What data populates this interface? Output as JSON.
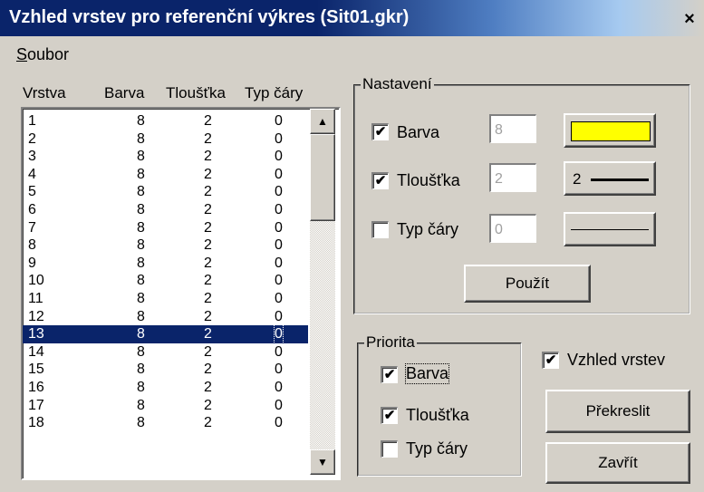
{
  "window": {
    "title": "Vzhled vrstev pro referenční výkres (Sit01.gkr)",
    "close_glyph": "×"
  },
  "menu": {
    "file": "Soubor",
    "file_underline_letter": "S",
    "file_rest": "oubor"
  },
  "layers": {
    "columns": [
      "Vrstva",
      "Barva",
      "Tloušťka",
      "Typ čáry"
    ],
    "rows": [
      [
        "1",
        "8",
        "2",
        "0"
      ],
      [
        "2",
        "8",
        "2",
        "0"
      ],
      [
        "3",
        "8",
        "2",
        "0"
      ],
      [
        "4",
        "8",
        "2",
        "0"
      ],
      [
        "5",
        "8",
        "2",
        "0"
      ],
      [
        "6",
        "8",
        "2",
        "0"
      ],
      [
        "7",
        "8",
        "2",
        "0"
      ],
      [
        "8",
        "8",
        "2",
        "0"
      ],
      [
        "9",
        "8",
        "2",
        "0"
      ],
      [
        "10",
        "8",
        "2",
        "0"
      ],
      [
        "11",
        "8",
        "2",
        "0"
      ],
      [
        "12",
        "8",
        "2",
        "0"
      ],
      [
        "13",
        "8",
        "2",
        "0"
      ],
      [
        "14",
        "8",
        "2",
        "0"
      ],
      [
        "15",
        "8",
        "2",
        "0"
      ],
      [
        "16",
        "8",
        "2",
        "0"
      ],
      [
        "17",
        "8",
        "2",
        "0"
      ],
      [
        "18",
        "8",
        "2",
        "0"
      ]
    ],
    "selected_index": 12
  },
  "settings": {
    "legend": "Nastavení",
    "color": {
      "checked": true,
      "label": "Barva",
      "value": "8",
      "swatch_color": "#ffff00"
    },
    "thickness": {
      "checked": true,
      "label": "Tloušťka",
      "value": "2",
      "button_label": "2"
    },
    "linetype": {
      "checked": false,
      "label": "Typ čáry",
      "value": "0"
    },
    "apply_label": "Použít"
  },
  "priority": {
    "legend": "Priorita",
    "color": {
      "checked": true,
      "label": "Barva"
    },
    "thickness": {
      "checked": true,
      "label": "Tloušťka"
    },
    "linetype": {
      "checked": false,
      "label": "Typ čáry"
    }
  },
  "appearance": {
    "checked": true,
    "label": "Vzhled vrstev"
  },
  "buttons": {
    "redraw": "Překreslit",
    "close": "Zavřít"
  },
  "icons": {
    "check": "✔",
    "scroll_up": "▲",
    "scroll_down": "▼"
  }
}
